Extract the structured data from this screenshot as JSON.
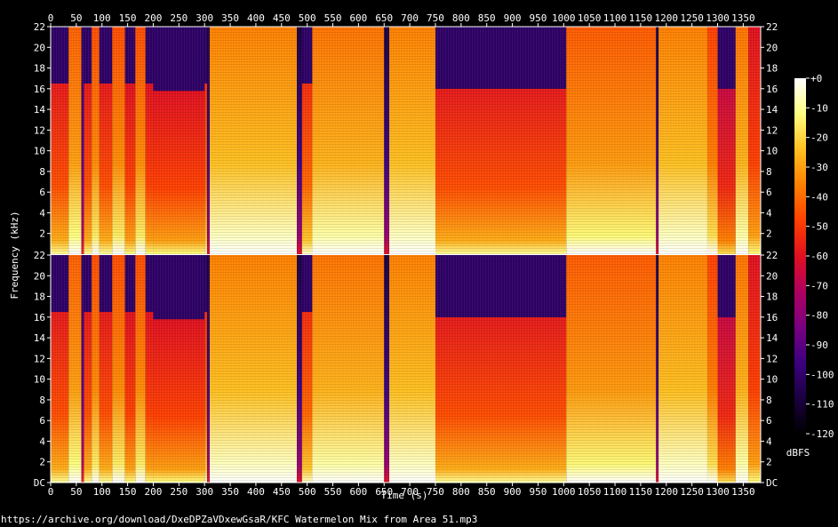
{
  "chart_data": {
    "type": "heatmap",
    "subtype": "spectrogram",
    "channels": 2,
    "xlabel": "Time (s)",
    "ylabel": "Frequency (kHz)",
    "xlim": [
      0,
      1384
    ],
    "ylim": [
      0,
      22
    ],
    "x_ticks": [
      "0",
      "50",
      "100",
      "150",
      "200",
      "250",
      "300",
      "350",
      "400",
      "450",
      "500",
      "550",
      "600",
      "650",
      "700",
      "750",
      "800",
      "850",
      "900",
      "950",
      "1000",
      "1050",
      "1100",
      "1150",
      "1200",
      "1250",
      "1300",
      "1350"
    ],
    "y_ticks": [
      "DC",
      "2",
      "4",
      "6",
      "8",
      "10",
      "12",
      "14",
      "16",
      "18",
      "20",
      "22"
    ],
    "colorbar": {
      "label": "dBFS",
      "range": [
        -120,
        0
      ],
      "ticks": [
        "+0",
        "-10",
        "-20",
        "-30",
        "-40",
        "-50",
        "-60",
        "-70",
        "-80",
        "-90",
        "-100",
        "-110",
        "-120"
      ],
      "colors": [
        "#000000",
        "#1a0040",
        "#3c0080",
        "#7a0080",
        "#b00060",
        "#e01020",
        "#ff4000",
        "#ff8000",
        "#ffc020",
        "#ffff80",
        "#ffffff"
      ]
    },
    "segments": [
      {
        "start": 0,
        "end": 35,
        "cutoff_khz": 16.5,
        "level": 0.62
      },
      {
        "start": 35,
        "end": 60,
        "cutoff_khz": 22,
        "level": 0.75
      },
      {
        "start": 60,
        "end": 65,
        "cutoff_khz": 22,
        "level": 0.25
      },
      {
        "start": 65,
        "end": 80,
        "cutoff_khz": 16.5,
        "level": 0.62
      },
      {
        "start": 80,
        "end": 95,
        "cutoff_khz": 22,
        "level": 0.72
      },
      {
        "start": 95,
        "end": 120,
        "cutoff_khz": 16.5,
        "level": 0.62
      },
      {
        "start": 120,
        "end": 145,
        "cutoff_khz": 22,
        "level": 0.72
      },
      {
        "start": 145,
        "end": 165,
        "cutoff_khz": 16.5,
        "level": 0.6
      },
      {
        "start": 165,
        "end": 185,
        "cutoff_khz": 22,
        "level": 0.72
      },
      {
        "start": 185,
        "end": 200,
        "cutoff_khz": 16.5,
        "level": 0.6
      },
      {
        "start": 200,
        "end": 300,
        "cutoff_khz": 15.8,
        "level": 0.6
      },
      {
        "start": 300,
        "end": 305,
        "cutoff_khz": 16.5,
        "level": 0.66
      },
      {
        "start": 305,
        "end": 310,
        "cutoff_khz": 22,
        "level": 0.2
      },
      {
        "start": 310,
        "end": 480,
        "cutoff_khz": 22,
        "level": 0.8
      },
      {
        "start": 480,
        "end": 490,
        "cutoff_khz": 22,
        "level": 0.2
      },
      {
        "start": 490,
        "end": 510,
        "cutoff_khz": 16.5,
        "level": 0.66
      },
      {
        "start": 510,
        "end": 650,
        "cutoff_khz": 22,
        "level": 0.78
      },
      {
        "start": 650,
        "end": 660,
        "cutoff_khz": 22,
        "level": 0.2
      },
      {
        "start": 660,
        "end": 750,
        "cutoff_khz": 22,
        "level": 0.8
      },
      {
        "start": 750,
        "end": 1005,
        "cutoff_khz": 16,
        "level": 0.62
      },
      {
        "start": 1005,
        "end": 1180,
        "cutoff_khz": 22,
        "level": 0.74
      },
      {
        "start": 1180,
        "end": 1185,
        "cutoff_khz": 22,
        "level": 0.2
      },
      {
        "start": 1185,
        "end": 1280,
        "cutoff_khz": 22,
        "level": 0.8
      },
      {
        "start": 1280,
        "end": 1300,
        "cutoff_khz": 22,
        "level": 0.7
      },
      {
        "start": 1300,
        "end": 1335,
        "cutoff_khz": 16,
        "level": 0.55
      },
      {
        "start": 1335,
        "end": 1360,
        "cutoff_khz": 22,
        "level": 0.78
      },
      {
        "start": 1360,
        "end": 1384,
        "cutoff_khz": 22,
        "level": 0.6
      }
    ]
  },
  "footer_text": "https://archive.org/download/DxeDPZaVDxewGsaR/KFC Watermelon Mix from Area 51.mp3"
}
